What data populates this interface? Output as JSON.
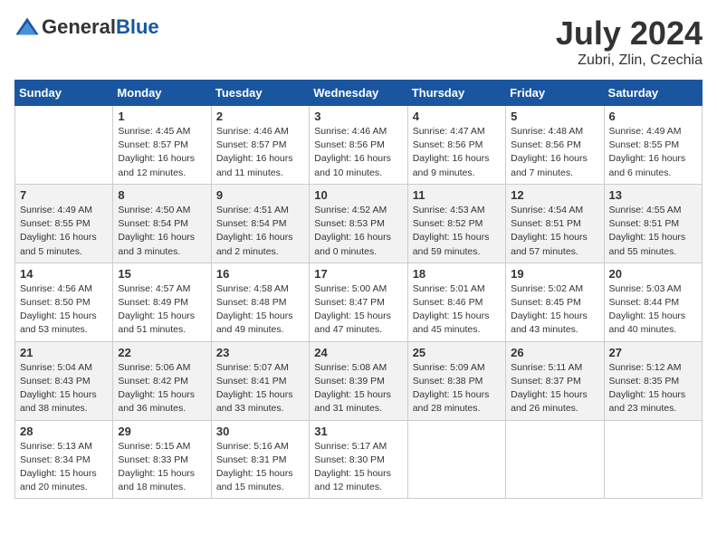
{
  "header": {
    "logo_general": "General",
    "logo_blue": "Blue",
    "month_title": "July 2024",
    "location": "Zubri, Zlin, Czechia"
  },
  "calendar": {
    "days_of_week": [
      "Sunday",
      "Monday",
      "Tuesday",
      "Wednesday",
      "Thursday",
      "Friday",
      "Saturday"
    ],
    "weeks": [
      [
        {
          "day": "",
          "info": ""
        },
        {
          "day": "1",
          "info": "Sunrise: 4:45 AM\nSunset: 8:57 PM\nDaylight: 16 hours\nand 12 minutes."
        },
        {
          "day": "2",
          "info": "Sunrise: 4:46 AM\nSunset: 8:57 PM\nDaylight: 16 hours\nand 11 minutes."
        },
        {
          "day": "3",
          "info": "Sunrise: 4:46 AM\nSunset: 8:56 PM\nDaylight: 16 hours\nand 10 minutes."
        },
        {
          "day": "4",
          "info": "Sunrise: 4:47 AM\nSunset: 8:56 PM\nDaylight: 16 hours\nand 9 minutes."
        },
        {
          "day": "5",
          "info": "Sunrise: 4:48 AM\nSunset: 8:56 PM\nDaylight: 16 hours\nand 7 minutes."
        },
        {
          "day": "6",
          "info": "Sunrise: 4:49 AM\nSunset: 8:55 PM\nDaylight: 16 hours\nand 6 minutes."
        }
      ],
      [
        {
          "day": "7",
          "info": "Sunrise: 4:49 AM\nSunset: 8:55 PM\nDaylight: 16 hours\nand 5 minutes."
        },
        {
          "day": "8",
          "info": "Sunrise: 4:50 AM\nSunset: 8:54 PM\nDaylight: 16 hours\nand 3 minutes."
        },
        {
          "day": "9",
          "info": "Sunrise: 4:51 AM\nSunset: 8:54 PM\nDaylight: 16 hours\nand 2 minutes."
        },
        {
          "day": "10",
          "info": "Sunrise: 4:52 AM\nSunset: 8:53 PM\nDaylight: 16 hours\nand 0 minutes."
        },
        {
          "day": "11",
          "info": "Sunrise: 4:53 AM\nSunset: 8:52 PM\nDaylight: 15 hours\nand 59 minutes."
        },
        {
          "day": "12",
          "info": "Sunrise: 4:54 AM\nSunset: 8:51 PM\nDaylight: 15 hours\nand 57 minutes."
        },
        {
          "day": "13",
          "info": "Sunrise: 4:55 AM\nSunset: 8:51 PM\nDaylight: 15 hours\nand 55 minutes."
        }
      ],
      [
        {
          "day": "14",
          "info": "Sunrise: 4:56 AM\nSunset: 8:50 PM\nDaylight: 15 hours\nand 53 minutes."
        },
        {
          "day": "15",
          "info": "Sunrise: 4:57 AM\nSunset: 8:49 PM\nDaylight: 15 hours\nand 51 minutes."
        },
        {
          "day": "16",
          "info": "Sunrise: 4:58 AM\nSunset: 8:48 PM\nDaylight: 15 hours\nand 49 minutes."
        },
        {
          "day": "17",
          "info": "Sunrise: 5:00 AM\nSunset: 8:47 PM\nDaylight: 15 hours\nand 47 minutes."
        },
        {
          "day": "18",
          "info": "Sunrise: 5:01 AM\nSunset: 8:46 PM\nDaylight: 15 hours\nand 45 minutes."
        },
        {
          "day": "19",
          "info": "Sunrise: 5:02 AM\nSunset: 8:45 PM\nDaylight: 15 hours\nand 43 minutes."
        },
        {
          "day": "20",
          "info": "Sunrise: 5:03 AM\nSunset: 8:44 PM\nDaylight: 15 hours\nand 40 minutes."
        }
      ],
      [
        {
          "day": "21",
          "info": "Sunrise: 5:04 AM\nSunset: 8:43 PM\nDaylight: 15 hours\nand 38 minutes."
        },
        {
          "day": "22",
          "info": "Sunrise: 5:06 AM\nSunset: 8:42 PM\nDaylight: 15 hours\nand 36 minutes."
        },
        {
          "day": "23",
          "info": "Sunrise: 5:07 AM\nSunset: 8:41 PM\nDaylight: 15 hours\nand 33 minutes."
        },
        {
          "day": "24",
          "info": "Sunrise: 5:08 AM\nSunset: 8:39 PM\nDaylight: 15 hours\nand 31 minutes."
        },
        {
          "day": "25",
          "info": "Sunrise: 5:09 AM\nSunset: 8:38 PM\nDaylight: 15 hours\nand 28 minutes."
        },
        {
          "day": "26",
          "info": "Sunrise: 5:11 AM\nSunset: 8:37 PM\nDaylight: 15 hours\nand 26 minutes."
        },
        {
          "day": "27",
          "info": "Sunrise: 5:12 AM\nSunset: 8:35 PM\nDaylight: 15 hours\nand 23 minutes."
        }
      ],
      [
        {
          "day": "28",
          "info": "Sunrise: 5:13 AM\nSunset: 8:34 PM\nDaylight: 15 hours\nand 20 minutes."
        },
        {
          "day": "29",
          "info": "Sunrise: 5:15 AM\nSunset: 8:33 PM\nDaylight: 15 hours\nand 18 minutes."
        },
        {
          "day": "30",
          "info": "Sunrise: 5:16 AM\nSunset: 8:31 PM\nDaylight: 15 hours\nand 15 minutes."
        },
        {
          "day": "31",
          "info": "Sunrise: 5:17 AM\nSunset: 8:30 PM\nDaylight: 15 hours\nand 12 minutes."
        },
        {
          "day": "",
          "info": ""
        },
        {
          "day": "",
          "info": ""
        },
        {
          "day": "",
          "info": ""
        }
      ]
    ]
  }
}
